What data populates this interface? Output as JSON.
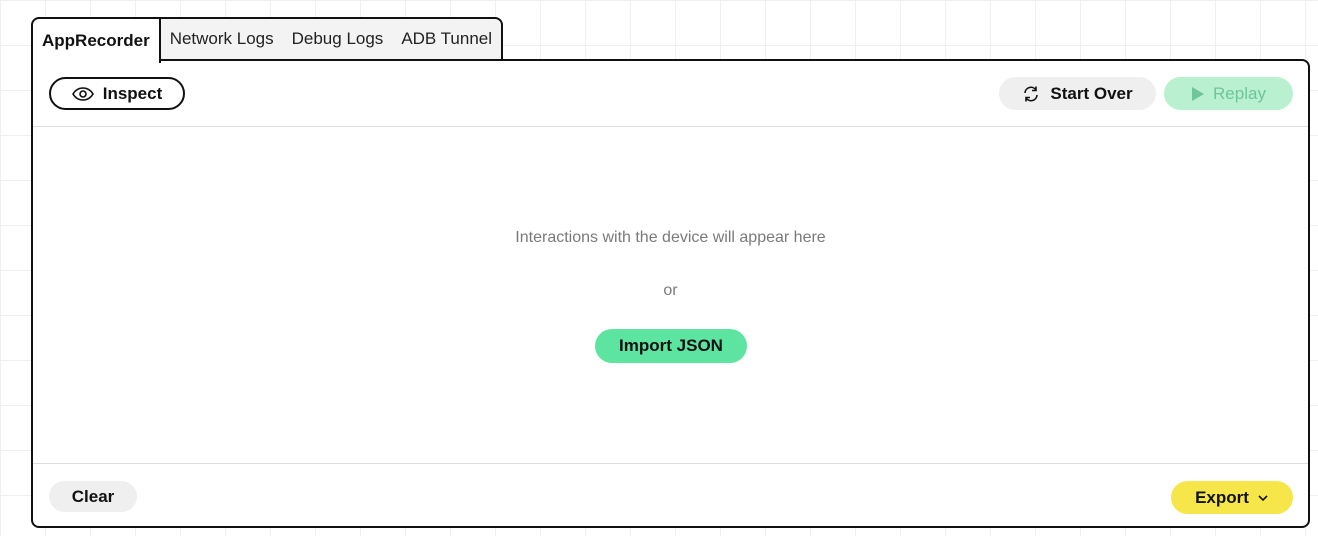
{
  "tabs": [
    {
      "label": "AppRecorder",
      "active": true
    },
    {
      "label": "Network Logs",
      "active": false
    },
    {
      "label": "Debug Logs",
      "active": false
    },
    {
      "label": "ADB Tunnel",
      "active": false
    }
  ],
  "toolbar": {
    "inspect_label": "Inspect",
    "inspect_icon": "eye-icon",
    "start_over_label": "Start Over",
    "start_over_icon": "refresh-icon",
    "replay_label": "Replay",
    "replay_icon": "play-icon"
  },
  "main": {
    "empty_message": "Interactions with the device will appear here",
    "or_text": "or",
    "import_label": "Import JSON"
  },
  "footer": {
    "clear_label": "Clear",
    "export_label": "Export",
    "export_icon": "chevron-down-icon"
  },
  "colors": {
    "replay_bg": "#b8f0d0",
    "replay_text": "#6ec59a",
    "import_bg": "#5de4a0",
    "export_bg": "#f7e64a",
    "neutral_button_bg": "#efefef"
  }
}
